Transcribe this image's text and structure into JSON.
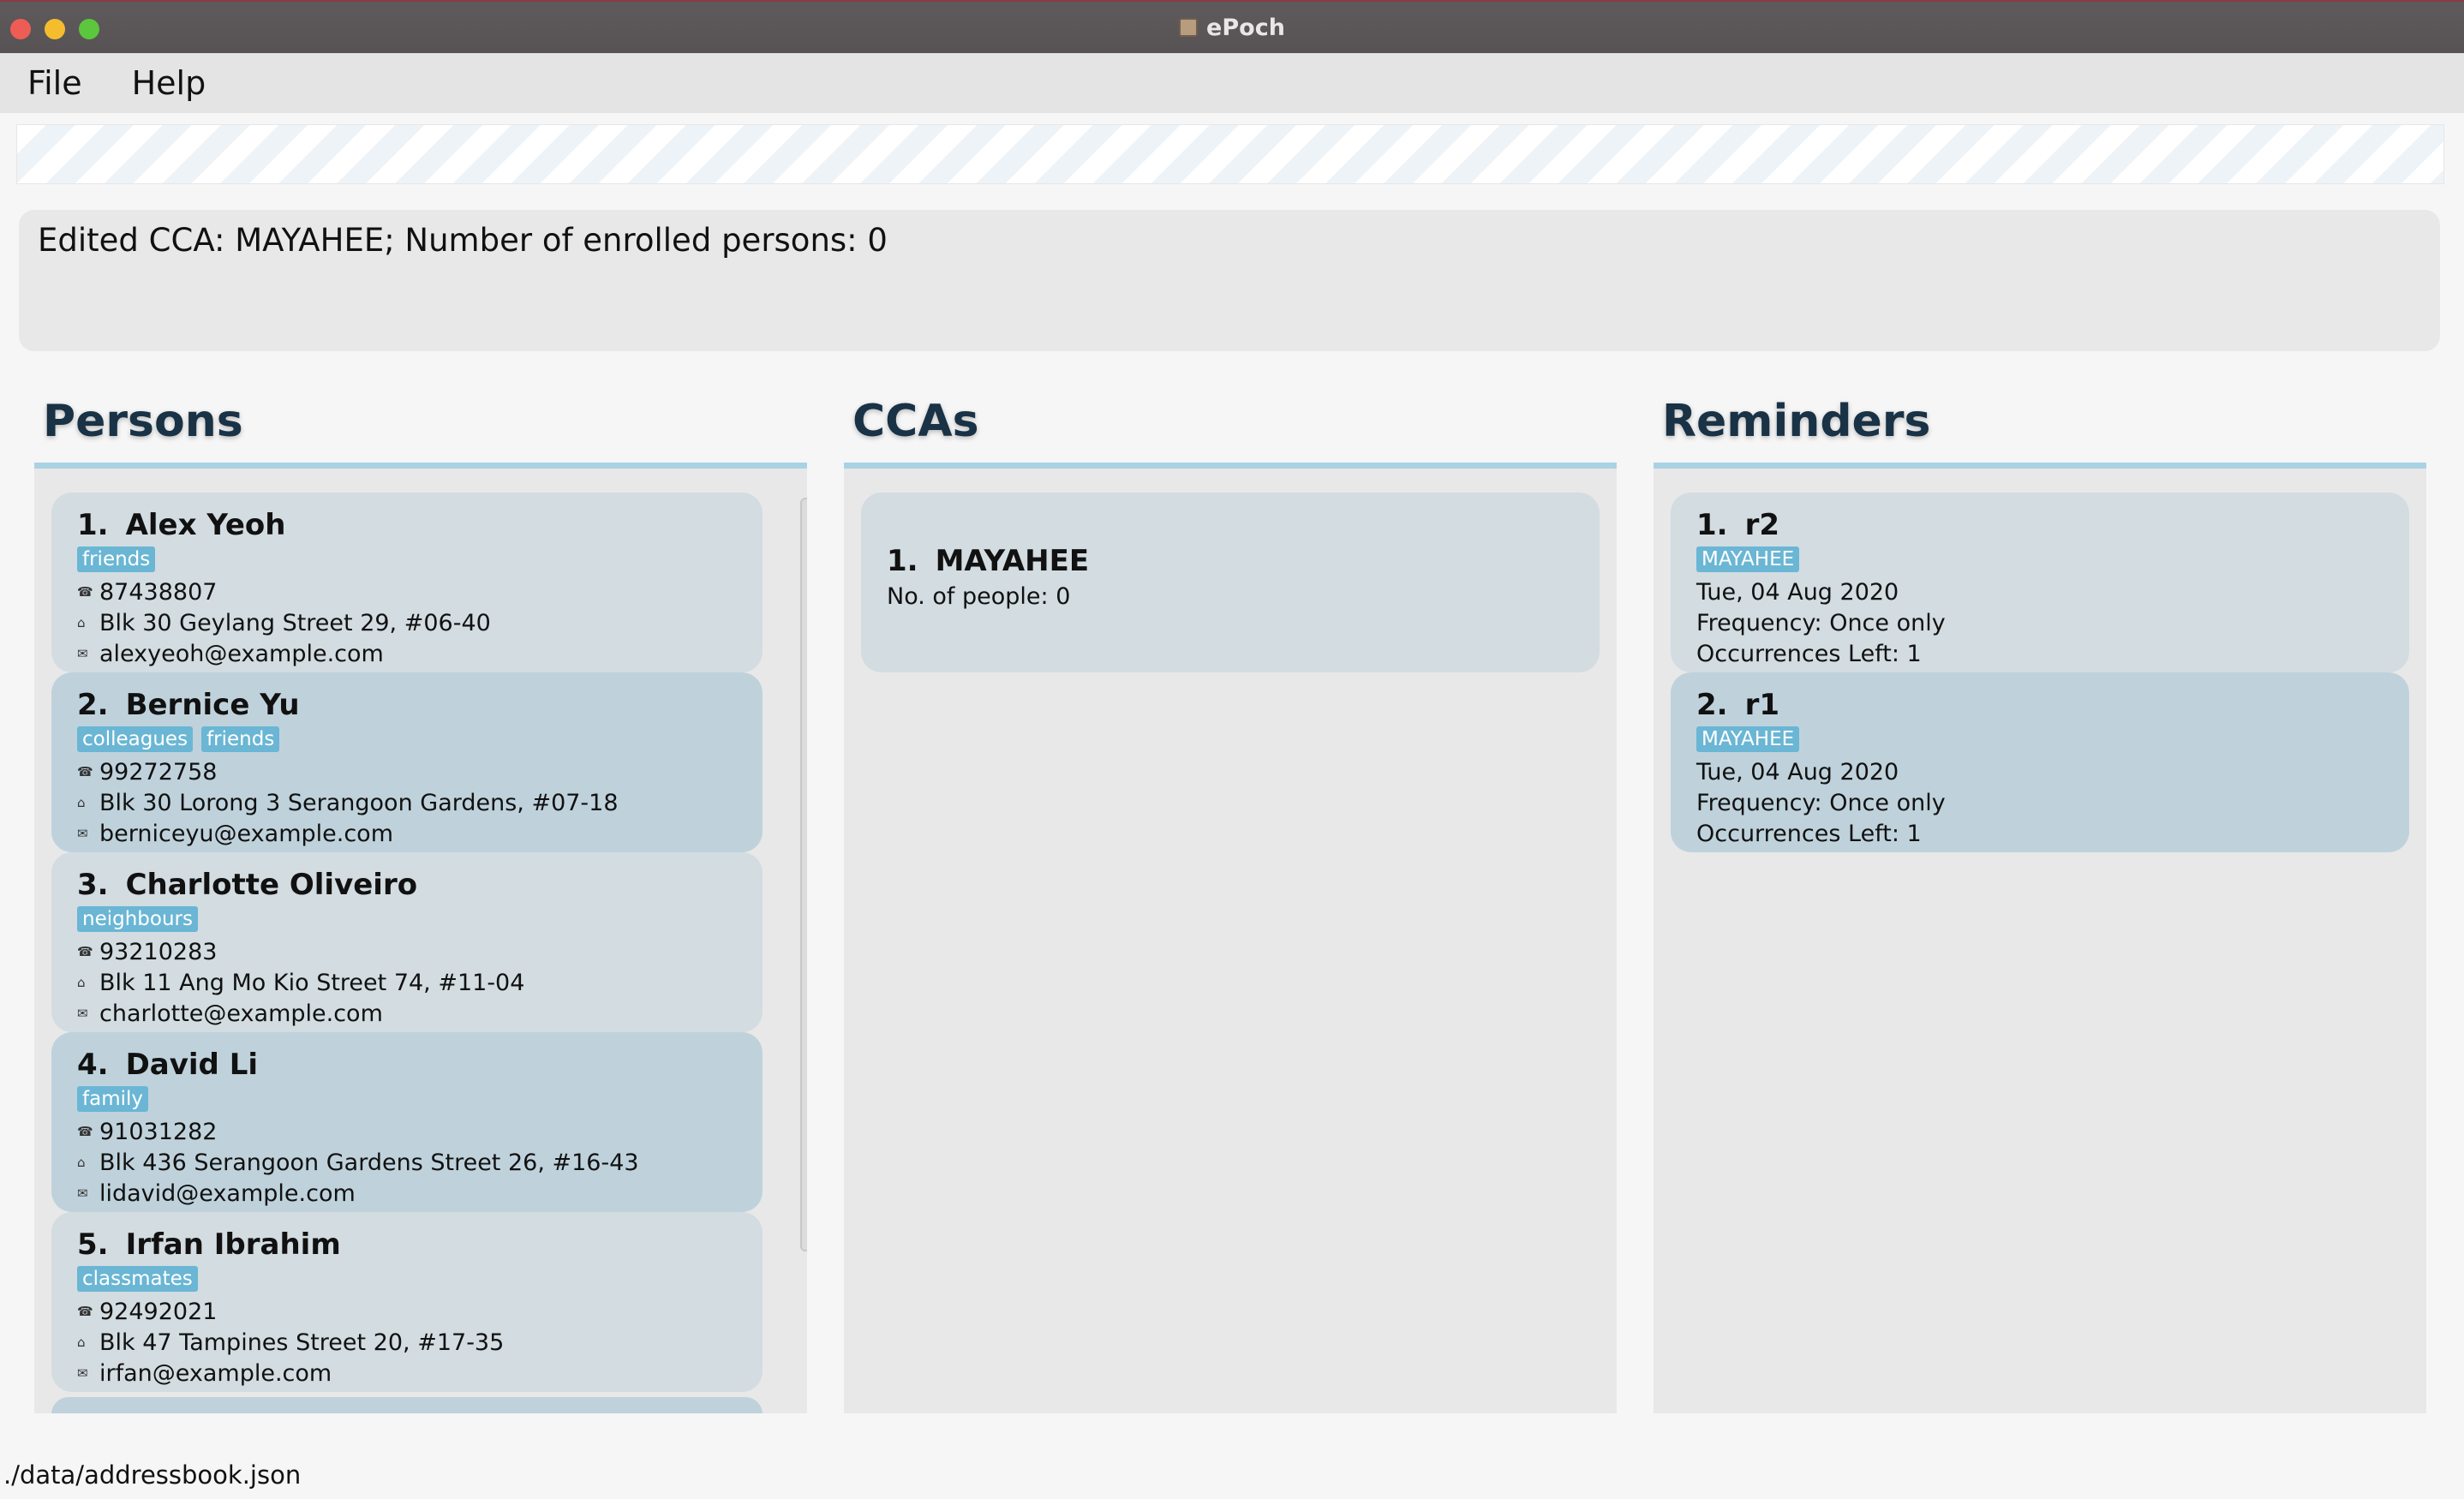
{
  "window": {
    "title": "ePoch"
  },
  "menu": {
    "file": "File",
    "help": "Help"
  },
  "command_box": {
    "value": ""
  },
  "result": {
    "text": "Edited CCA: MAYAHEE; Number of enrolled persons: 0"
  },
  "persons": {
    "title": "Persons",
    "items": [
      {
        "index": "1.",
        "name": "Alex Yeoh",
        "tags": [
          "friends"
        ],
        "phone": "87438807",
        "address": "Blk 30 Geylang Street 29, #06-40",
        "email": "alexyeoh@example.com"
      },
      {
        "index": "2.",
        "name": "Bernice Yu",
        "tags": [
          "colleagues",
          "friends"
        ],
        "phone": "99272758",
        "address": "Blk 30 Lorong 3 Serangoon Gardens, #07-18",
        "email": "berniceyu@example.com"
      },
      {
        "index": "3.",
        "name": "Charlotte Oliveiro",
        "tags": [
          "neighbours"
        ],
        "phone": "93210283",
        "address": "Blk 11 Ang Mo Kio Street 74, #11-04",
        "email": "charlotte@example.com"
      },
      {
        "index": "4.",
        "name": "David Li",
        "tags": [
          "family"
        ],
        "phone": "91031282",
        "address": "Blk 436 Serangoon Gardens Street 26, #16-43",
        "email": "lidavid@example.com"
      },
      {
        "index": "5.",
        "name": "Irfan Ibrahim",
        "tags": [
          "classmates"
        ],
        "phone": "92492021",
        "address": "Blk 47 Tampines Street 20, #17-35",
        "email": "irfan@example.com"
      }
    ]
  },
  "ccas": {
    "title": "CCAs",
    "items": [
      {
        "index": "1.",
        "name": "MAYAHEE",
        "people": "No. of people: 0"
      }
    ]
  },
  "reminders": {
    "title": "Reminders",
    "items": [
      {
        "index": "1.",
        "name": "r2",
        "tag": "MAYAHEE",
        "date": "Tue, 04 Aug 2020",
        "frequency": "Frequency: Once only",
        "occurrences": "Occurrences Left: 1"
      },
      {
        "index": "2.",
        "name": "r1",
        "tag": "MAYAHEE",
        "date": "Tue, 04 Aug 2020",
        "frequency": "Frequency: Once only",
        "occurrences": "Occurrences Left: 1"
      }
    ]
  },
  "status_bar": {
    "path": "./data/addressbook.json"
  },
  "icons": {
    "phone": "phone-icon",
    "address": "home-icon",
    "email": "mail-icon"
  }
}
